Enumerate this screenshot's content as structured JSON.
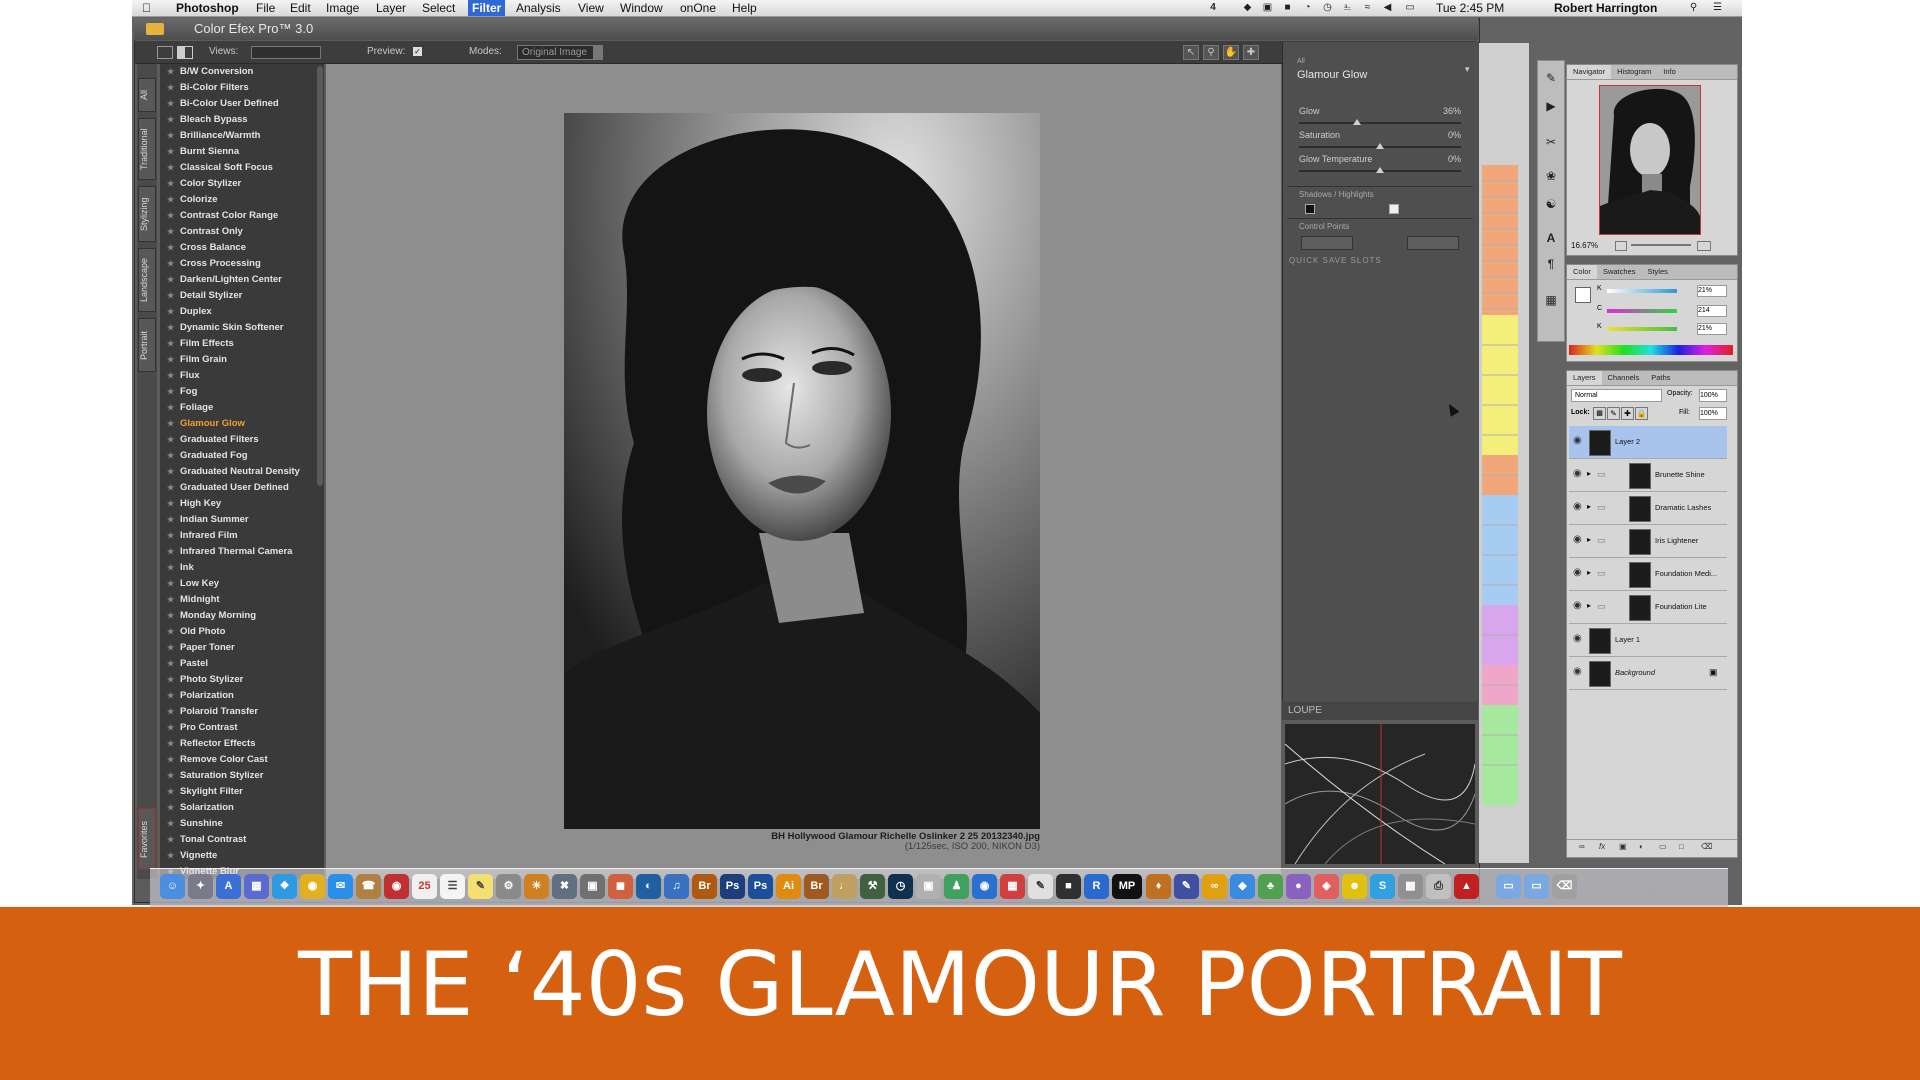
{
  "menubar": {
    "app_name": "Photoshop",
    "menus": [
      "File",
      "Edit",
      "Image",
      "Layer",
      "Select",
      "Filter",
      "Analysis",
      "View",
      "Window",
      "onOne",
      "Help"
    ],
    "active_menu": "Filter",
    "clock": "Tue 2:45 PM",
    "user": "Robert Harrington",
    "status_badge": "4"
  },
  "plugin": {
    "title": "Color Efex Pro™ 3.0",
    "toolbar": {
      "views_label": "Views:",
      "preview_label": "Preview:",
      "modes_label": "Modes:",
      "modes_value": "Original Image"
    },
    "category_tabs": [
      "All",
      "Traditional",
      "Stylizing",
      "Landscape",
      "Portrait",
      "Favorites"
    ],
    "filters": [
      "B/W Conversion",
      "Bi-Color Filters",
      "Bi-Color User Defined",
      "Bleach Bypass",
      "Brilliance/Warmth",
      "Burnt Sienna",
      "Classical Soft Focus",
      "Color Stylizer",
      "Colorize",
      "Contrast Color Range",
      "Contrast Only",
      "Cross Balance",
      "Cross Processing",
      "Darken/Lighten Center",
      "Detail Stylizer",
      "Duplex",
      "Dynamic Skin Softener",
      "Film Effects",
      "Film Grain",
      "Flux",
      "Fog",
      "Foliage",
      "Glamour Glow",
      "Graduated Filters",
      "Graduated Fog",
      "Graduated Neutral Density",
      "Graduated User Defined",
      "High Key",
      "Indian Summer",
      "Infrared Film",
      "Infrared Thermal Camera",
      "Ink",
      "Low Key",
      "Midnight",
      "Monday Morning",
      "Old Photo",
      "Paper Toner",
      "Pastel",
      "Photo Stylizer",
      "Polarization",
      "Polaroid Transfer",
      "Pro Contrast",
      "Reflector Effects",
      "Remove Color Cast",
      "Saturation Stylizer",
      "Skylight Filter",
      "Solarization",
      "Sunshine",
      "Tonal Contrast",
      "Vignette",
      "Vignette Blur"
    ],
    "active_filter": "Glamour Glow",
    "photo_caption_line1": "BH Hollywood Glamour Richelle Oslinker 2 25 20132340.jpg",
    "photo_caption_line2": "(1/125sec, ISO 200, NIKON D3)",
    "controls": {
      "category_label": "All",
      "filter_name": "Glamour Glow",
      "sliders": [
        {
          "label": "Glow",
          "value": "36%",
          "level": 0.36
        },
        {
          "label": "Saturation",
          "value": "0%",
          "level": 0.5
        },
        {
          "label": "Glow Temperature",
          "value": "0%",
          "level": 0.5
        }
      ],
      "shadows_label": "Shadows / Highlights",
      "control_points_label": "Control Points",
      "quick_save_label": "QUICK SAVE SLOTS",
      "loupe_label": "LOUPE"
    }
  },
  "ps_panels": {
    "navigator_tabs": [
      "Navigator",
      "Histogram",
      "Info"
    ],
    "zoom": "16.67%",
    "color_tabs": [
      "Color",
      "Swatches",
      "Styles"
    ],
    "color_values": {
      "k1": "21%",
      "c": "214",
      "k2": "21%"
    },
    "layers_tabs": [
      "Layers",
      "Channels",
      "Paths"
    ],
    "blend_mode": "Normal",
    "opacity_label": "Opacity:",
    "opacity_value": "100%",
    "lock_label": "Lock:",
    "fill_label": "Fill:",
    "fill_value": "100%",
    "layers": [
      "Layer 2",
      "Brunette Shine",
      "Dramatic Lashes",
      "Iris Lightener",
      "Foundation Medi...",
      "Foundation Lite",
      "Layer 1",
      "Background"
    ],
    "selected_layer": "Layer 2"
  },
  "dock_labels": [
    "Br",
    "Ps",
    "Ps",
    "Ai",
    "Br",
    "R",
    "MP",
    "S"
  ],
  "banner_title": "THE ‘40s GLAMOUR PORTRAIT",
  "colors": {
    "banner": "#d56010",
    "active_filter": "#f0a030",
    "selected_layer": "#a9c4ec",
    "menu_highlight": "#2f68d6"
  }
}
